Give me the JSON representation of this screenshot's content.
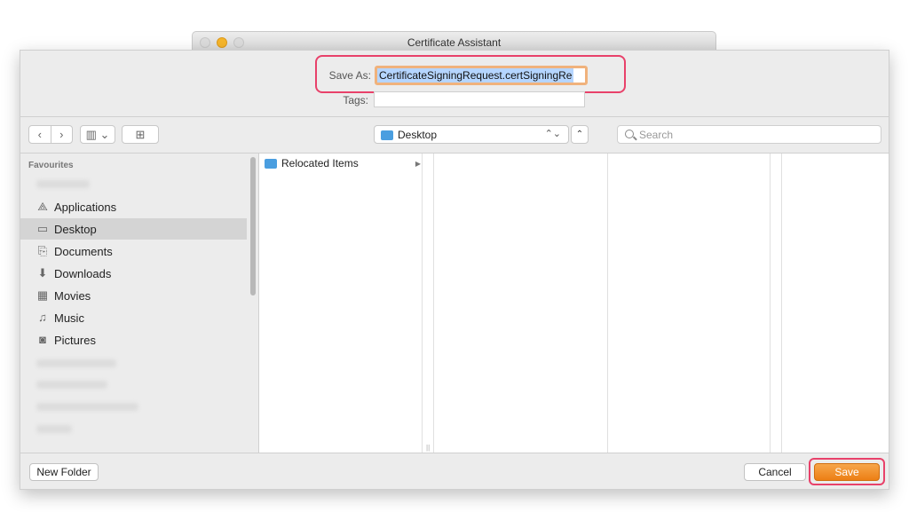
{
  "window": {
    "title": "Certificate Assistant"
  },
  "save_panel": {
    "save_as_label": "Save As:",
    "save_as_value": "CertificateSigningRequest.certSigningRe",
    "tags_label": "Tags:",
    "tags_value": ""
  },
  "toolbar": {
    "back_glyph": "‹",
    "forward_glyph": "›",
    "view_glyph": "▥ ⌄",
    "new_folder_glyph": "⊞",
    "location": "Desktop",
    "location_arrows": "⌃⌄",
    "collapse_glyph": "⌃",
    "search_placeholder": "Search"
  },
  "sidebar": {
    "heading": "Favourites",
    "items": [
      {
        "label": "Applications",
        "icon": "applications-icon",
        "glyph": "⟁"
      },
      {
        "label": "Desktop",
        "icon": "desktop-icon",
        "glyph": "▭"
      },
      {
        "label": "Documents",
        "icon": "documents-icon",
        "glyph": "⎘"
      },
      {
        "label": "Downloads",
        "icon": "downloads-icon",
        "glyph": "⬇"
      },
      {
        "label": "Movies",
        "icon": "movies-icon",
        "glyph": "▦"
      },
      {
        "label": "Music",
        "icon": "music-icon",
        "glyph": "♫"
      },
      {
        "label": "Pictures",
        "icon": "pictures-icon",
        "glyph": "◙"
      }
    ]
  },
  "browser": {
    "items": [
      {
        "name": "Relocated Items",
        "arrow": "▶"
      }
    ]
  },
  "footer": {
    "new_folder": "New Folder",
    "cancel": "Cancel",
    "save": "Save"
  },
  "colors": {
    "accent": "#ec7f14",
    "highlight": "#e8416a",
    "selection": "#b5d5ff",
    "folder": "#4a9ee0"
  }
}
